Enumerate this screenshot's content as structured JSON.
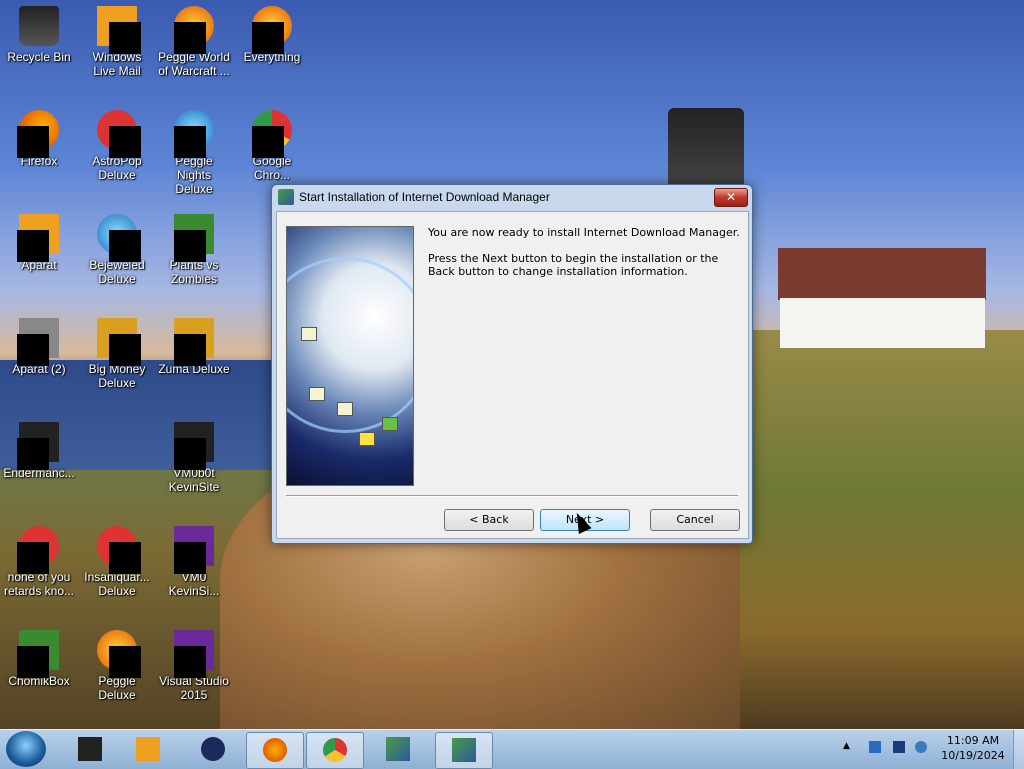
{
  "desktop": {
    "icons": [
      {
        "label": "Recycle Bin",
        "icon": "recycle-bin-icon"
      },
      {
        "label": "Windows Live Mail",
        "icon": "mail-icon"
      },
      {
        "label": "Peggle World of Warcraft ...",
        "icon": "game-icon"
      },
      {
        "label": "Everything",
        "icon": "search-icon"
      },
      {
        "label": "Firefox",
        "icon": "firefox-icon"
      },
      {
        "label": "AstroPop Deluxe",
        "icon": "game-icon"
      },
      {
        "label": "Peggle Nights Deluxe",
        "icon": "game-icon"
      },
      {
        "label": "Google Chro...",
        "icon": "chrome-icon"
      },
      {
        "label": "Aparat",
        "icon": "app-icon"
      },
      {
        "label": "Bejeweled Deluxe",
        "icon": "game-icon"
      },
      {
        "label": "Plants vs Zombies",
        "icon": "game-icon"
      },
      {
        "label": "Aparat (2)",
        "icon": "app-icon"
      },
      {
        "label": "Big Money Deluxe",
        "icon": "game-icon"
      },
      {
        "label": "Zuma Deluxe",
        "icon": "game-icon"
      },
      {
        "label": "Endermanc...",
        "icon": "app-icon"
      },
      {
        "label": "VM0b0t KevinSite",
        "icon": "folder-icon"
      },
      {
        "label": "none of you retards kno...",
        "icon": "app-icon"
      },
      {
        "label": "Insaniquar... Deluxe",
        "icon": "game-icon"
      },
      {
        "label": "VM0 KevinSi...",
        "icon": "folder-icon"
      },
      {
        "label": "ChomikBox",
        "icon": "app-icon"
      },
      {
        "label": "Peggle Deluxe",
        "icon": "game-icon"
      },
      {
        "label": "Visual Studio 2015",
        "icon": "visual-studio-icon"
      }
    ]
  },
  "dialog": {
    "title": "Start Installation of Internet Download Manager",
    "close_label": "✕",
    "message1": "You are now ready to install Internet Download Manager.",
    "message2": "Press the Next button to begin the installation or the Back button to change installation information.",
    "back_label": "< Back",
    "next_label": "Next >",
    "cancel_label": "Cancel"
  },
  "taskbar": {
    "items": [
      "app-icon",
      "media-player-icon",
      "globe-icon",
      "firefox-icon",
      "chrome-icon",
      "installer-icon",
      "installer-icon"
    ],
    "clock_time": "11:09 AM",
    "clock_date": "10/19/2024",
    "tray_expand": "▲"
  }
}
